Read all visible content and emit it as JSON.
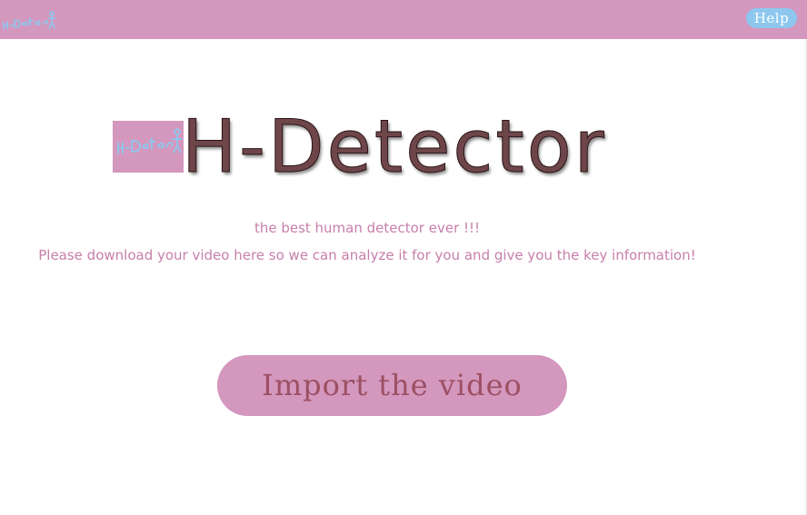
{
  "header": {
    "logo_icon": "h-detector-logo-icon",
    "help_label": "Help"
  },
  "hero": {
    "logo_icon": "h-detector-logo-icon",
    "logo_text": "H-Detector",
    "title": "H-Detector",
    "tagline": "the best human detector ever !!!",
    "instructions": "Please download your video here so we can analyze it for you and give you the key information!"
  },
  "actions": {
    "import_label": "Import the video"
  },
  "colors": {
    "bar": "#d497bd",
    "help_button": "#8dc7ee",
    "title_text": "#6e464a",
    "accent_text": "#c77fab",
    "button_text": "#9c5063"
  }
}
